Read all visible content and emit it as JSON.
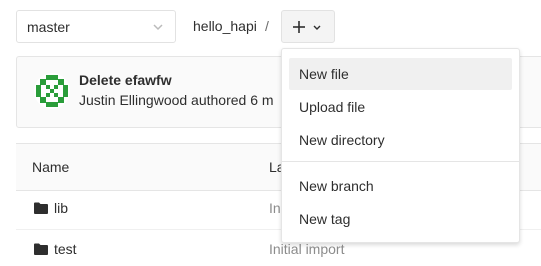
{
  "toolbar": {
    "branch": "master",
    "project_path": "hello_hapi",
    "path_separator": "/",
    "add_icon": "plus-icon",
    "add_chevron_icon": "chevron-down-icon"
  },
  "commit": {
    "title": "Delete efawfw",
    "meta": "Justin Ellingwood authored 6 m",
    "avatar_icon": "identicon-avatar",
    "avatar_color": "#2a9d3a"
  },
  "table": {
    "headers": [
      "Name",
      "La"
    ],
    "rows": [
      {
        "name": "lib",
        "message": "In",
        "icon": "folder-icon"
      },
      {
        "name": "test",
        "message": "Initial import",
        "icon": "folder-icon"
      }
    ]
  },
  "dropdown": {
    "items": [
      {
        "label": "New file",
        "active": true
      },
      {
        "label": "Upload file"
      },
      {
        "label": "New directory"
      },
      {
        "label": "New branch"
      },
      {
        "label": "New tag"
      }
    ]
  },
  "colors": {
    "active_item_bg": "#f0f0f0",
    "border": "#e5e5e5",
    "muted_text": "#8c8c8c"
  }
}
